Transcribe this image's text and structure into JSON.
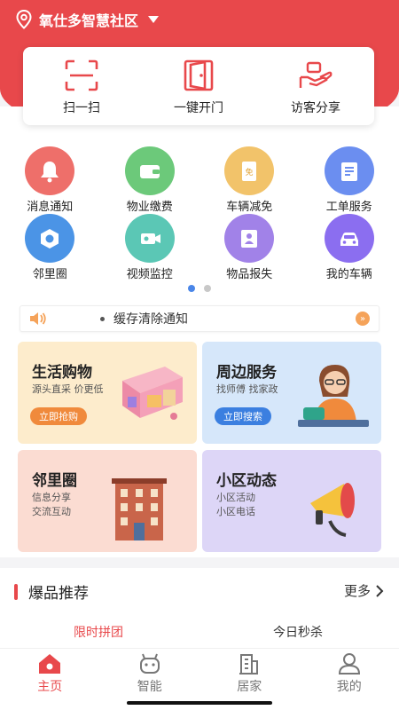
{
  "header": {
    "community": "氧仕多智慧社区"
  },
  "quick_actions": [
    {
      "label": "扫一扫",
      "icon": "scan-icon"
    },
    {
      "label": "一键开门",
      "icon": "door-icon"
    },
    {
      "label": "访客分享",
      "icon": "visitor-share-icon"
    }
  ],
  "services": [
    {
      "label": "消息通知",
      "icon": "bell-icon",
      "color": "#ee6f6a"
    },
    {
      "label": "物业缴费",
      "icon": "wallet-icon",
      "color": "#6cc97a"
    },
    {
      "label": "车辆减免",
      "icon": "coupon-icon",
      "color": "#f2c36a"
    },
    {
      "label": "工单服务",
      "icon": "work-order-icon",
      "color": "#6b8ef0"
    },
    {
      "label": "邻里圈",
      "icon": "neighbor-circle-icon",
      "color": "#4b94e6"
    },
    {
      "label": "视频监控",
      "icon": "camera-icon",
      "color": "#5bc7b5"
    },
    {
      "label": "物品报失",
      "icon": "lost-item-icon",
      "color": "#a182e8"
    },
    {
      "label": "我的车辆",
      "icon": "car-icon",
      "color": "#8b6ef0"
    }
  ],
  "pager": {
    "active": 0,
    "count": 2
  },
  "notice": {
    "text": "缓存清除通知",
    "more_symbol": "»"
  },
  "cards": [
    {
      "title": "生活购物",
      "sub1": "源头直采 价更低",
      "sub2": "",
      "button": "立即抢购",
      "bg": "#fdeccc",
      "btn_color": "#f08a3c"
    },
    {
      "title": "周边服务",
      "sub1": "找师傅 找家政",
      "sub2": "",
      "button": "立即搜索",
      "bg": "#d6e7fa",
      "btn_color": "#3b7fe0"
    },
    {
      "title": "邻里圈",
      "sub1": "信息分享",
      "sub2": "交流互动",
      "button": "",
      "bg": "#fbdcd2",
      "btn_color": ""
    },
    {
      "title": "小区动态",
      "sub1": "小区活动",
      "sub2": "小区电话",
      "button": "",
      "bg": "#ddd6f7",
      "btn_color": ""
    }
  ],
  "recommend": {
    "title": "爆品推荐",
    "more": "更多",
    "tabs": [
      {
        "label": "限时拼团",
        "active": true
      },
      {
        "label": "今日秒杀",
        "active": false
      }
    ]
  },
  "nav": [
    {
      "label": "主页",
      "icon": "home-icon",
      "active": true
    },
    {
      "label": "智能",
      "icon": "robot-icon",
      "active": false
    },
    {
      "label": "居家",
      "icon": "building-icon",
      "active": false
    },
    {
      "label": "我的",
      "icon": "user-icon",
      "active": false
    }
  ],
  "colors": {
    "brand": "#e8484b",
    "pager_active": "#4a86e8"
  }
}
